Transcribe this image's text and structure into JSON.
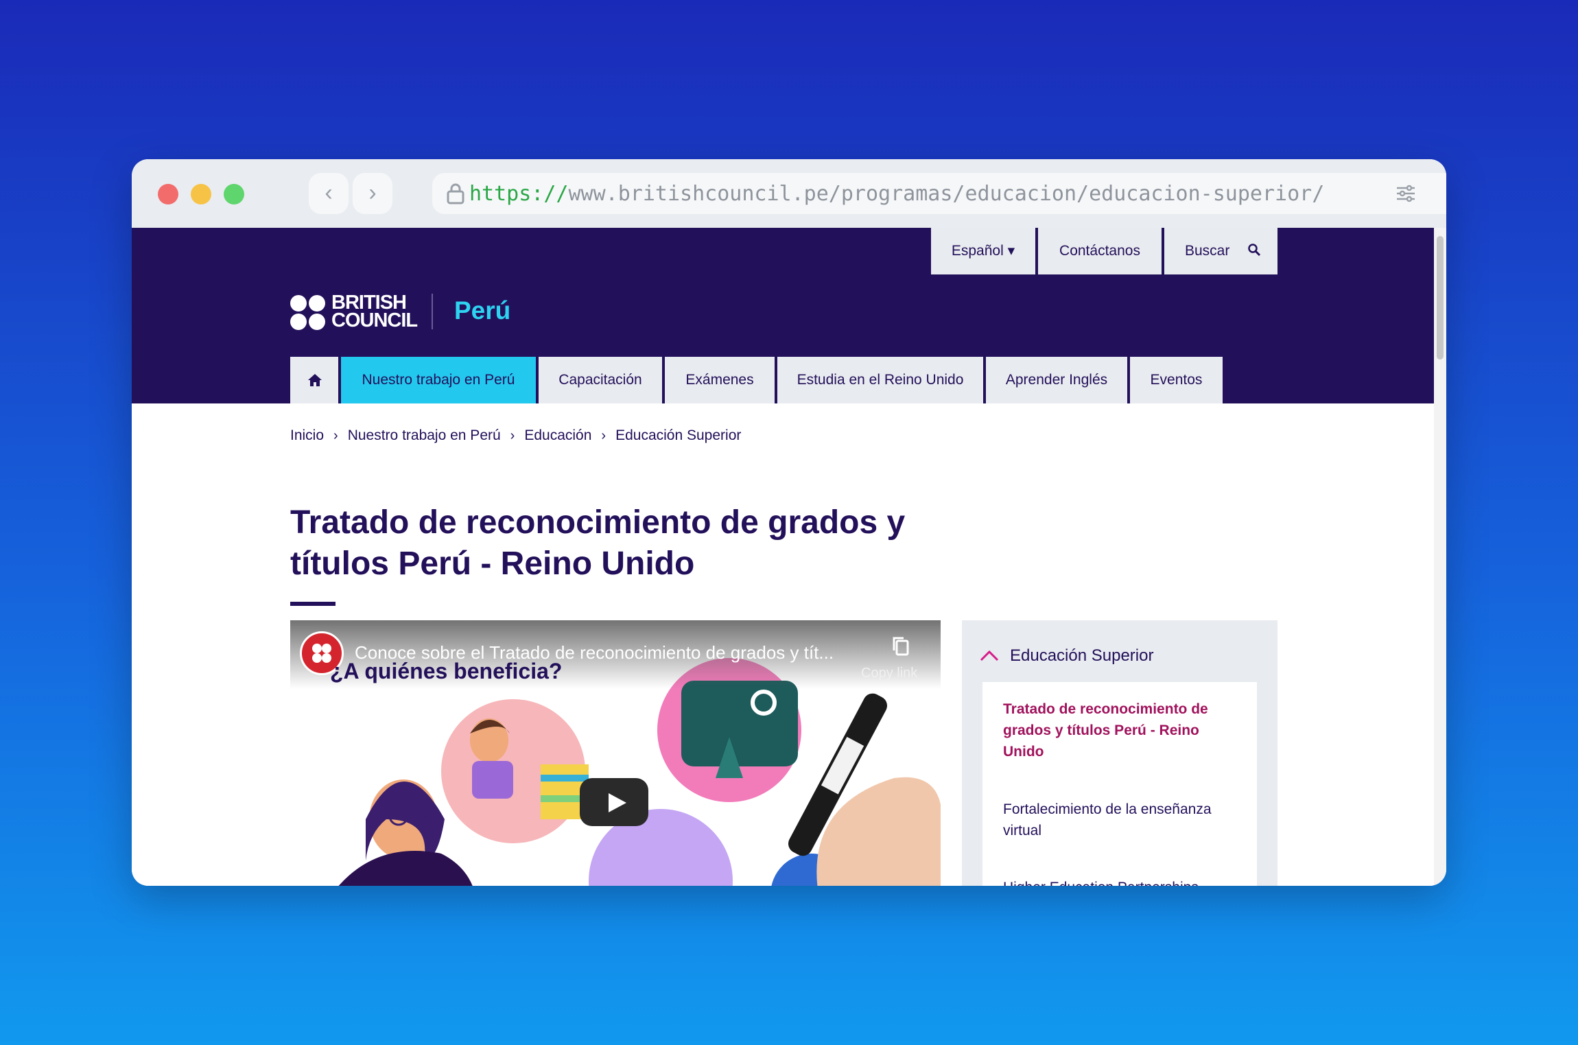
{
  "browser": {
    "url_scheme": "https://",
    "url_rest": "www.britishcouncil.pe/programas/educacion/educacion-superior/"
  },
  "utility_nav": {
    "language": "Español ▾",
    "contact": "Contáctanos",
    "search": "Buscar"
  },
  "logo": {
    "line1": "BRITISH",
    "line2": "COUNCIL",
    "country": "Perú"
  },
  "main_nav": [
    {
      "label": "Nuestro trabajo en Perú",
      "active": true
    },
    {
      "label": "Capacitación"
    },
    {
      "label": "Exámenes"
    },
    {
      "label": "Estudia en el Reino Unido"
    },
    {
      "label": "Aprender Inglés"
    },
    {
      "label": "Eventos"
    }
  ],
  "breadcrumb": [
    "Inicio",
    "Nuestro trabajo en Perú",
    "Educación",
    "Educación Superior"
  ],
  "page": {
    "title": "Tratado de reconocimiento de grados y títulos Perú - Reino Unido"
  },
  "video": {
    "title": "Conoce sobre el Tratado de reconocimiento de grados y tít...",
    "heading": "¿A quiénes beneficia?",
    "copy_link": "Copy link"
  },
  "sidebar": {
    "heading": "Educación Superior",
    "items": [
      {
        "label": "Tratado de reconocimiento de grados y títulos Perú - Reino Unido",
        "active": true
      },
      {
        "label": "Fortalecimiento de la enseñanza virtual"
      },
      {
        "label": "Higher Education Partnerships"
      }
    ]
  },
  "colors": {
    "brand_navy": "#23105a",
    "accent_cyan": "#23c8ee",
    "active_magenta": "#a1125c"
  }
}
